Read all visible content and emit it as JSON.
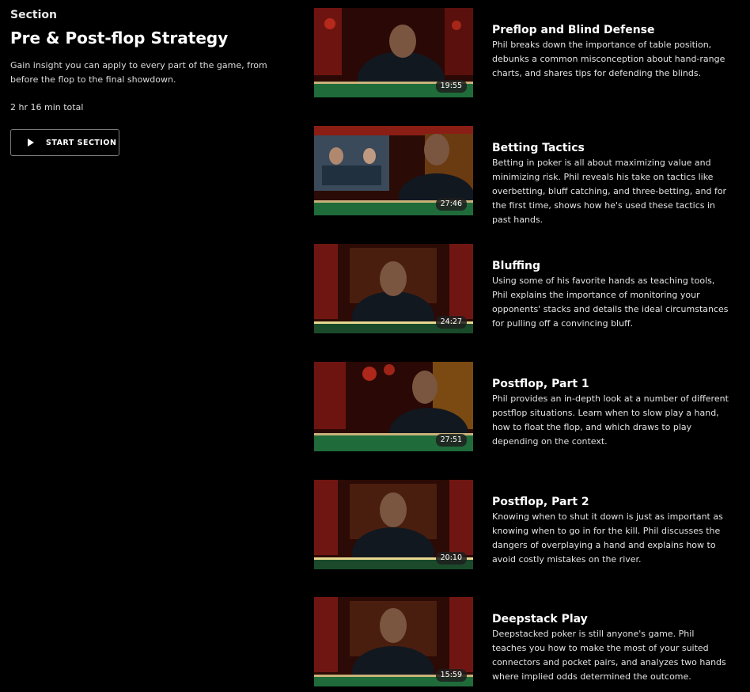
{
  "section": {
    "eyebrow": "Section",
    "title": "Pre & Post-flop Strategy",
    "description": "Gain insight you can apply to every part of the game, from before the flop to the final showdown.",
    "total": "2 hr 16 min total",
    "start_label": "START SECTION"
  },
  "lessons": [
    {
      "title": "Preflop and Blind Defense",
      "description": "Phil breaks down the importance of table position, debunks a common misconception about hand-range charts, and shares tips for defending the blinds.",
      "duration": "19:55"
    },
    {
      "title": "Betting Tactics",
      "description": "Betting in poker is all about maximizing value and minimizing risk. Phil reveals his take on tactics like overbetting, bluff catching, and three-betting, and for the first time, shows how he's used these tactics in past hands.",
      "duration": "27:46"
    },
    {
      "title": "Bluffing",
      "description": "Using some of his favorite hands as teaching tools, Phil explains the importance of monitoring your opponents' stacks and details the ideal circumstances for pulling off a convincing bluff.",
      "duration": "24:27"
    },
    {
      "title": "Postflop, Part 1",
      "description": "Phil provides an in-depth look at a number of different postflop situations. Learn when to slow play a hand, how to float the flop, and which draws to play depending on the context.",
      "duration": "27:51"
    },
    {
      "title": "Postflop, Part 2",
      "description": "Knowing when to shut it down is just as important as knowing when to go in for the kill. Phil discusses the dangers of overplaying a hand and explains how to avoid costly mistakes on the river.",
      "duration": "20:10"
    },
    {
      "title": "Deepstack Play",
      "description": "Deepstacked poker is still anyone's game. Phil teaches you how to make the most of your suited connectors and pocket pairs, and analyzes two hands where implied odds determined the outcome.",
      "duration": "15:59"
    }
  ],
  "icons": {
    "play": "play-icon"
  },
  "colors": {
    "background": "#000000",
    "text": "#ffffff",
    "muted_text": "#dcdcdc",
    "button_border": "#7a7a7a",
    "table_felt": "#1f6b3a"
  }
}
